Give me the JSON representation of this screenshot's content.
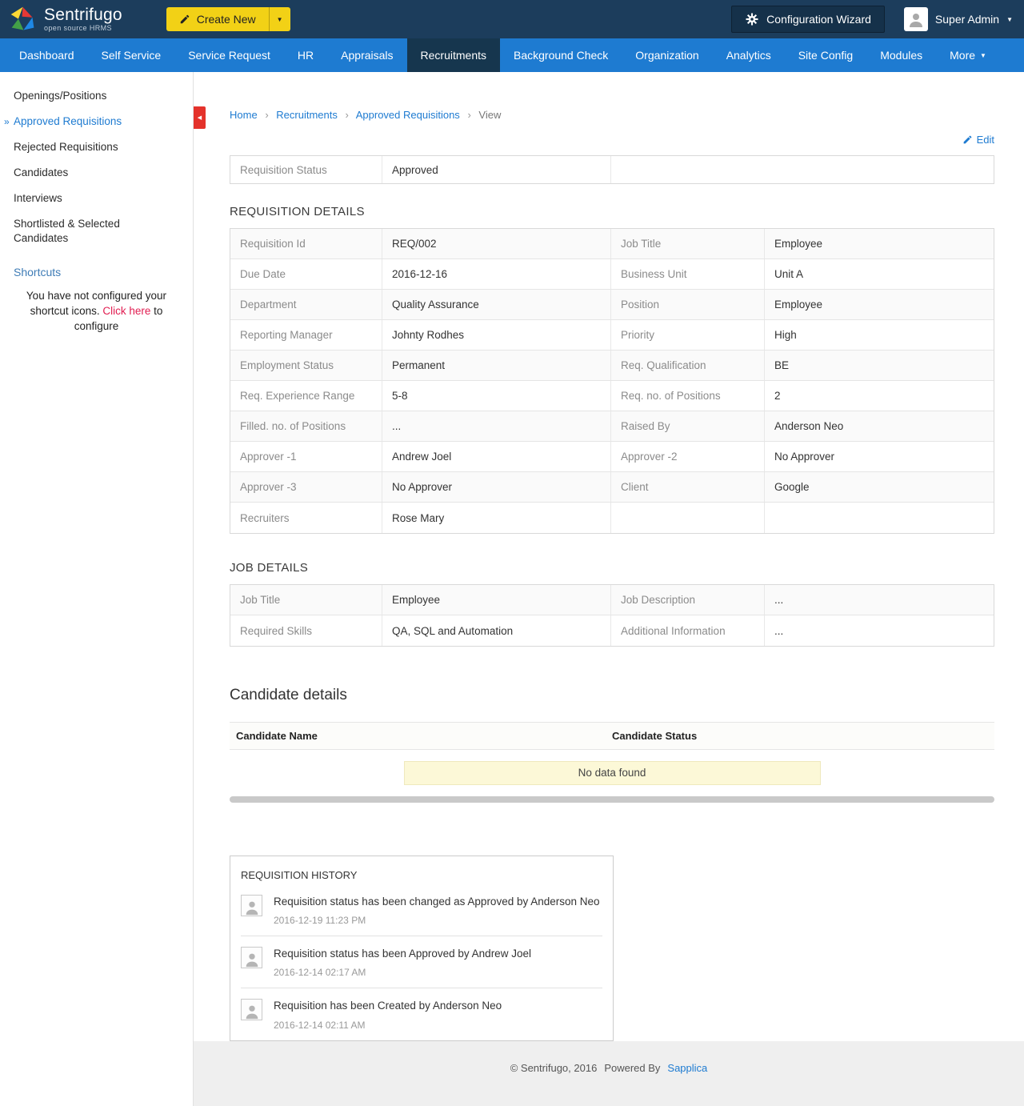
{
  "header": {
    "brand": "Sentrifugo",
    "tagline": "open source HRMS",
    "create_new_label": "Create New",
    "config_wizard_label": "Configuration Wizard",
    "user_label": "Super Admin"
  },
  "icons": {
    "caret": "▼",
    "collapse": "◀",
    "active_arrow": "»"
  },
  "colors": {
    "header_bg": "#1c3d5c",
    "nav_bg": "#1e7bd1",
    "nav_active_bg": "#16364e",
    "accent_blue": "#1e7bd1",
    "create_new_yellow": "#f2d116",
    "collapse_red": "#e4322b",
    "shortcut_link_red": "#e11d51",
    "no_data_bg": "#fcf8d7"
  },
  "nav": {
    "items": [
      {
        "label": "Dashboard"
      },
      {
        "label": "Self Service"
      },
      {
        "label": "Service Request"
      },
      {
        "label": "HR"
      },
      {
        "label": "Appraisals"
      },
      {
        "label": "Recruitments",
        "active": true
      },
      {
        "label": "Background Check"
      },
      {
        "label": "Organization"
      },
      {
        "label": "Analytics"
      },
      {
        "label": "Site Config"
      },
      {
        "label": "Modules"
      },
      {
        "label": "More"
      }
    ]
  },
  "sidebar": {
    "items": [
      "Openings/Positions",
      "Approved Requisitions",
      "Rejected Requisitions",
      "Candidates",
      "Interviews",
      "Shortlisted & Selected Candidates"
    ],
    "active_item": "Approved Requisitions",
    "shortcuts_title": "Shortcuts",
    "note_1": "You have not configured your shortcut icons. ",
    "note_link": "Click here",
    "note_2": " to configure"
  },
  "breadcrumb": {
    "separator": "›",
    "items": [
      "Home",
      "Recruitments",
      "Approved Requisitions"
    ],
    "current": "View"
  },
  "edit_label": "Edit",
  "status_row": {
    "label": "Requisition Status",
    "value": "Approved"
  },
  "requisition_details": {
    "title": "REQUISITION DETAILS",
    "rows": [
      {
        "l1": "Requisition Id",
        "v1": "REQ/002",
        "l2": "Job Title",
        "v2": "Employee"
      },
      {
        "l1": "Due Date",
        "v1": "2016-12-16",
        "l2": "Business Unit",
        "v2": "Unit A"
      },
      {
        "l1": "Department",
        "v1": "Quality Assurance",
        "l2": "Position",
        "v2": "Employee"
      },
      {
        "l1": "Reporting Manager",
        "v1": "Johnty Rodhes",
        "l2": "Priority",
        "v2": "High"
      },
      {
        "l1": "Employment Status",
        "v1": "Permanent",
        "l2": "Req. Qualification",
        "v2": "BE"
      },
      {
        "l1": "Req. Experience Range",
        "v1": "5-8",
        "l2": "Req. no. of Positions",
        "v2": "2"
      },
      {
        "l1": "Filled. no. of Positions",
        "v1": "...",
        "l2": "Raised By",
        "v2": "Anderson Neo"
      },
      {
        "l1": "Approver -1",
        "v1": "Andrew Joel",
        "l2": "Approver -2",
        "v2": "No Approver"
      },
      {
        "l1": "Approver -3",
        "v1": "No Approver",
        "l2": "Client",
        "v2": "Google"
      },
      {
        "l1": "Recruiters",
        "v1": "Rose Mary",
        "l2": "",
        "v2": ""
      }
    ]
  },
  "job_details": {
    "title": "JOB DETAILS",
    "rows": [
      {
        "l1": "Job Title",
        "v1": "Employee",
        "l2": "Job Description",
        "v2": "..."
      },
      {
        "l1": "Required Skills",
        "v1": "QA, SQL and Automation",
        "l2": "Additional Information",
        "v2": "..."
      }
    ]
  },
  "candidates": {
    "title": "Candidate details",
    "col1": "Candidate Name",
    "col2": "Candidate Status",
    "empty_message": "No data found"
  },
  "history": {
    "title": "REQUISITION HISTORY",
    "items": [
      {
        "text": "Requisition status has been changed as Approved by Anderson Neo",
        "time": "2016-12-19 11:23 PM"
      },
      {
        "text": "Requisition status has been Approved by Andrew Joel",
        "time": "2016-12-14 02:17 AM"
      },
      {
        "text": "Requisition has been Created by Anderson Neo",
        "time": "2016-12-14 02:11 AM"
      }
    ]
  },
  "footer": {
    "copyright": "© Sentrifugo, 2016",
    "powered_by": "Powered By",
    "powered_link": "Sapplica"
  }
}
